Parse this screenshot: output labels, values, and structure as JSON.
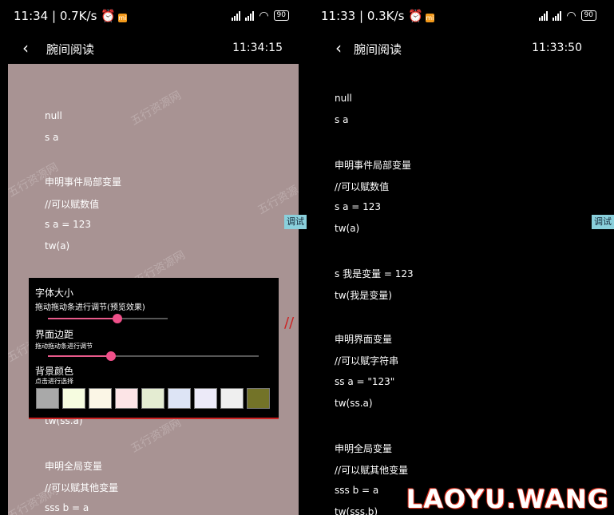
{
  "left": {
    "status": {
      "time": "11:34",
      "speed": "0.7K/s",
      "battery": "90"
    },
    "header": {
      "back": "‹",
      "title": "腕间阅读",
      "clock": "11:34:15"
    },
    "lines": [
      "null",
      "s a",
      "申明事件局部变量",
      "//可以赋数值",
      "s a = 123",
      "tw(a)",
      "tw(ss.a)",
      "申明全局变量",
      "//可以赋其他变量",
      "sss b = a"
    ],
    "watermarks": [
      "五行资源网",
      "五行资源网",
      "五行资源",
      "五行资源网",
      "五行资源",
      "五行资源网",
      "五行资源网"
    ],
    "debug_label": "调试",
    "panel": {
      "font_size_title": "字体大小",
      "font_size_desc": "拖动拖动条进行调节(预览效果)",
      "font_size_value": 0.58,
      "margin_title": "界面边距",
      "margin_desc": "拖动拖动条进行调节",
      "margin_value": 0.3,
      "bg_title": "背景颜色",
      "bg_desc": "点击进行选择",
      "swatches": [
        "#a9a9a9",
        "#f6fce0",
        "#fbf6e6",
        "#fce4e6",
        "#e4ecd2",
        "#dde4f5",
        "#eceaf8",
        "#efefef",
        "#737328"
      ]
    },
    "red_mark": "//"
  },
  "right": {
    "status": {
      "time": "11:33",
      "speed": "0.3K/s",
      "battery": "90"
    },
    "header": {
      "back": "‹",
      "title": "腕间阅读",
      "clock": "11:33:50"
    },
    "lines": [
      "null",
      "s a",
      "申明事件局部变量",
      "//可以赋数值",
      "s a = 123",
      "tw(a)",
      "s 我是变量 = 123",
      "tw(我是变量)",
      "申明界面变量",
      "//可以赋字符串",
      "ss a = \"123\"",
      "tw(ss.a)",
      "申明全局变量",
      "//可以赋其他变量",
      "sss b = a",
      "tw(sss.b)"
    ],
    "debug_label": "调试",
    "brand": "LAOYU.WANG"
  }
}
